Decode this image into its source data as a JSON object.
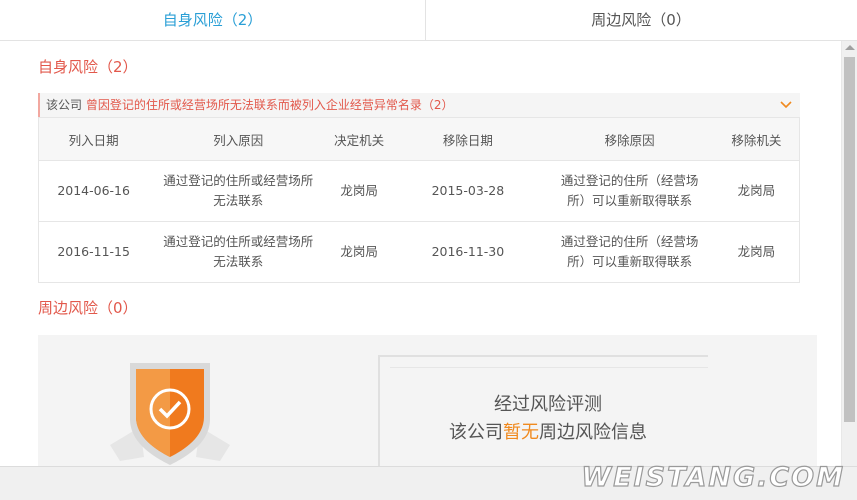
{
  "tabs": [
    {
      "label": "自身风险（2）",
      "active": true
    },
    {
      "label": "周边风险（0）",
      "active": false
    }
  ],
  "self_risk": {
    "title": "自身风险（2）",
    "group": {
      "subject": "该公司",
      "description": "曾因登记的住所或经营场所无法联系而被列入企业经营异常名录（2）"
    },
    "columns": [
      "列入日期",
      "列入原因",
      "决定机关",
      "移除日期",
      "移除原因",
      "移除机关"
    ],
    "rows": [
      {
        "list_date": "2014-06-16",
        "list_reason": "通过登记的住所或经营场所无法联系",
        "authority": "龙岗局",
        "remove_date": "2015-03-28",
        "remove_reason": "通过登记的住所（经营场所）可以重新取得联系",
        "remove_authority": "龙岗局"
      },
      {
        "list_date": "2016-11-15",
        "list_reason": "通过登记的住所或经营场所无法联系",
        "authority": "龙岗局",
        "remove_date": "2016-11-30",
        "remove_reason": "通过登记的住所（经营场所）可以重新取得联系",
        "remove_authority": "龙岗局"
      }
    ]
  },
  "nearby_risk": {
    "title": "周边风险（0）",
    "empty_line1": "经过风险评测",
    "empty_line2_pre": "该公司",
    "empty_line2_highlight": "暂无",
    "empty_line2_post": "周边风险信息"
  },
  "icons": {
    "expand": "chevron-down-icon",
    "badge": "shield-check-icon"
  },
  "colors": {
    "accent_blue": "#2a9fd6",
    "risk_red": "#e2584b",
    "highlight_orange": "#f08a1f"
  },
  "watermark": "WEISTANG.COM"
}
